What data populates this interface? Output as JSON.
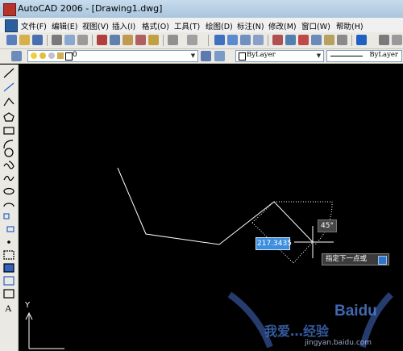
{
  "window": {
    "title": "AutoCAD 2006 - [Drawing1.dwg]"
  },
  "menu": {
    "items": [
      {
        "label": "文件(F)"
      },
      {
        "label": "编辑(E)"
      },
      {
        "label": "视图(V)"
      },
      {
        "label": "插入(I)"
      },
      {
        "label": "格式(O)"
      },
      {
        "label": "工具(T)"
      },
      {
        "label": "绘图(D)"
      },
      {
        "label": "标注(N)"
      },
      {
        "label": "修改(M)"
      },
      {
        "label": "窗口(W)"
      },
      {
        "label": "帮助(H)"
      }
    ]
  },
  "layers": {
    "current": "0"
  },
  "properties": {
    "color": "ByLayer",
    "linetype": "ByLayer"
  },
  "dynamic_input": {
    "distance": "217.3435",
    "angle": "45°",
    "prompt": "指定下一点或"
  },
  "ucs": {
    "y_label": "Y"
  },
  "watermark": {
    "logo": "Baidu",
    "text": "我爱…经验",
    "url": "jingyan.baidu.com"
  },
  "colors": {
    "canvas": "#000000",
    "line": "#ffffff",
    "input_highlight": "#3d8ede"
  }
}
